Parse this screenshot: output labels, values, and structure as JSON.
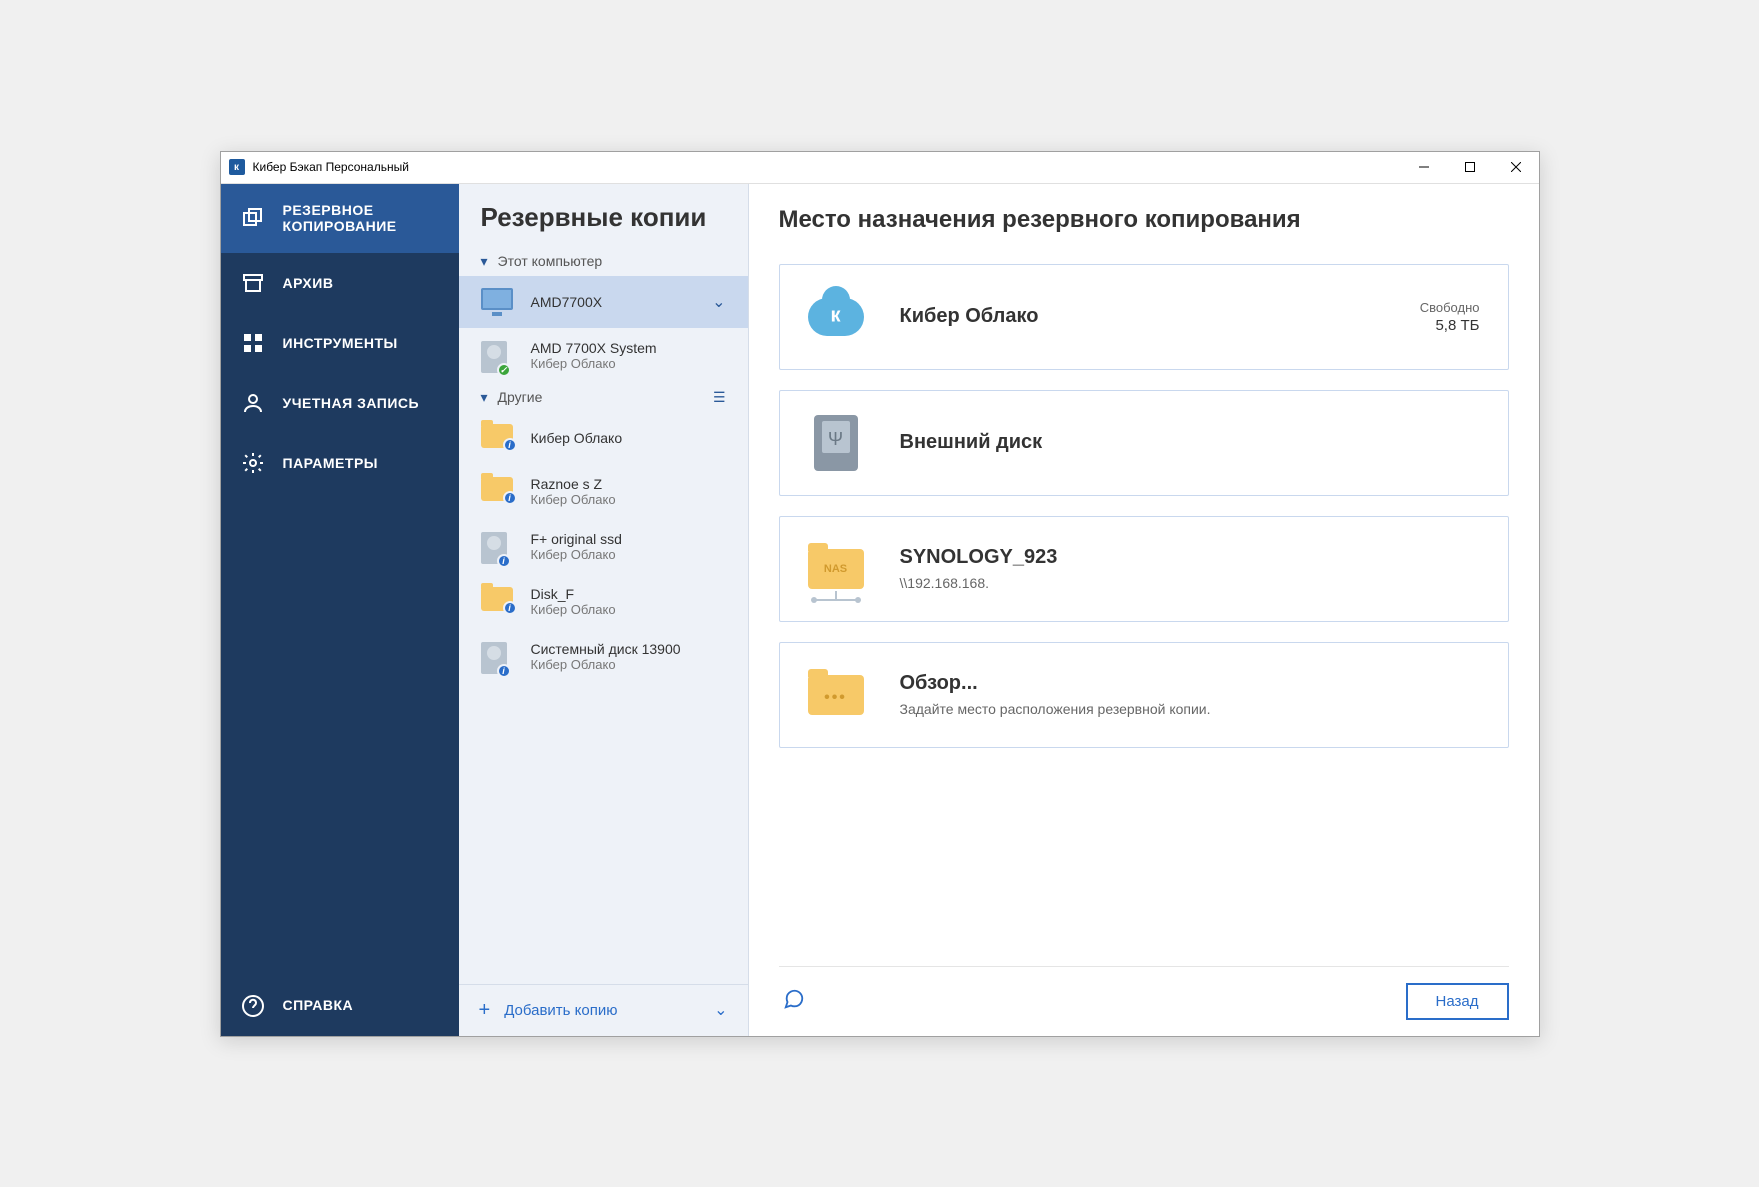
{
  "titlebar": {
    "title": "Кибер Бэкап Персональный"
  },
  "nav": {
    "items": [
      {
        "label": "РЕЗЕРВНОЕ КОПИРОВАНИЕ",
        "key": "backup"
      },
      {
        "label": "АРХИВ",
        "key": "archive"
      },
      {
        "label": "ИНСТРУМЕНТЫ",
        "key": "tools"
      },
      {
        "label": "УЧЕТНАЯ ЗАПИСЬ",
        "key": "account"
      },
      {
        "label": "ПАРАМЕТРЫ",
        "key": "settings"
      }
    ],
    "help": "СПРАВКА"
  },
  "panel": {
    "title": "Резервные копии",
    "section_this_pc": "Этот компьютер",
    "section_other": "Другие",
    "this_pc": [
      {
        "title": "AMD7700X",
        "sub": "",
        "icon": "monitor",
        "selected": true
      },
      {
        "title": "AMD 7700X System",
        "sub": "Кибер Облако",
        "icon": "hdd-ok"
      }
    ],
    "other": [
      {
        "title": "Кибер Облако",
        "sub": "",
        "icon": "folder"
      },
      {
        "title": "Raznoe s Z",
        "sub": "Кибер Облако",
        "icon": "folder"
      },
      {
        "title": "F+ original ssd",
        "sub": "Кибер Облако",
        "icon": "hdd"
      },
      {
        "title": "Disk_F",
        "sub": "Кибер Облако",
        "icon": "folder"
      },
      {
        "title": "Системный диск 13900",
        "sub": "Кибер Облако",
        "icon": "hdd"
      }
    ],
    "add": "Добавить копию"
  },
  "main": {
    "title": "Место назначения резервного копирования",
    "cards": [
      {
        "title": "Кибер Облако",
        "sub": "",
        "icon": "cloud",
        "free_label": "Свободно",
        "free_value": "5,8 ТБ"
      },
      {
        "title": "Внешний диск",
        "sub": "",
        "icon": "ext"
      },
      {
        "title": "SYNOLOGY_923",
        "sub": "\\\\192.168.168.",
        "icon": "nas"
      },
      {
        "title": "Обзор...",
        "sub": "Задайте место расположения резервной копии.",
        "icon": "browse"
      }
    ],
    "back": "Назад"
  }
}
